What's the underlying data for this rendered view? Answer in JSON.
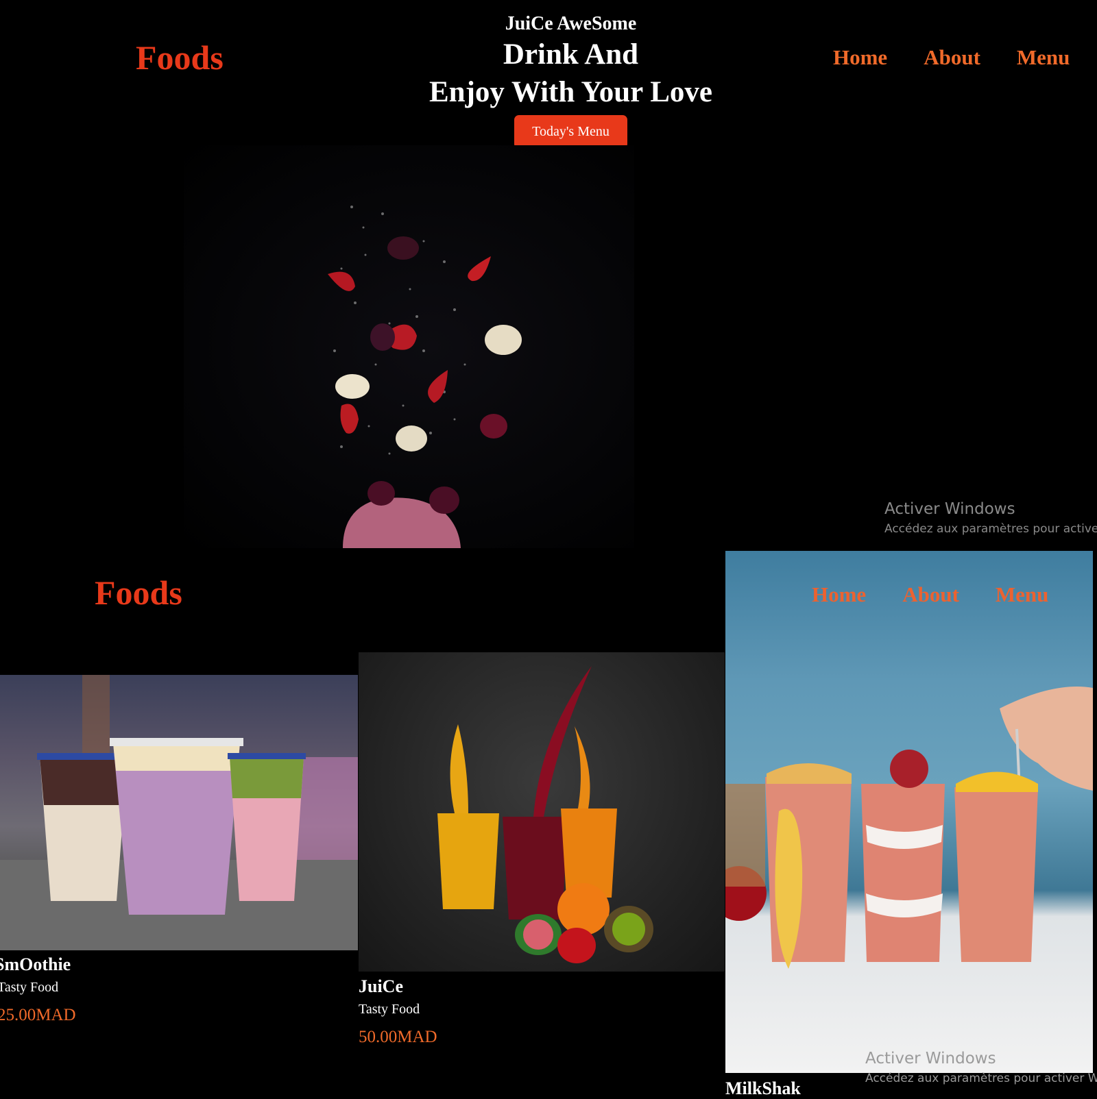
{
  "header": {
    "logo": "Foods",
    "nav": [
      "Home",
      "About",
      "Menu"
    ]
  },
  "hero": {
    "kicker": "JuiCe AweSome",
    "line1": "Drink And",
    "line2": "Enjoy With Your Love",
    "button": "Today's Menu"
  },
  "section": {
    "logo": "Foods",
    "overlay_nav": [
      "Home",
      "About",
      "Menu"
    ]
  },
  "products": [
    {
      "name": "SmOothie",
      "tagline": "Tasty Food",
      "price": "25.00MAD"
    },
    {
      "name": "JuiCe",
      "tagline": "Tasty Food",
      "price": "50.00MAD"
    },
    {
      "name": "MilkShak"
    }
  ],
  "watermark": {
    "title": "Activer Windows",
    "subtitle_1": "Accédez aux paramètres pour active",
    "subtitle_2": "Accédez aux paramètres pour activer W"
  },
  "colors": {
    "accent": "#e8391a",
    "nav": "#f06a2a",
    "background": "#000000"
  }
}
